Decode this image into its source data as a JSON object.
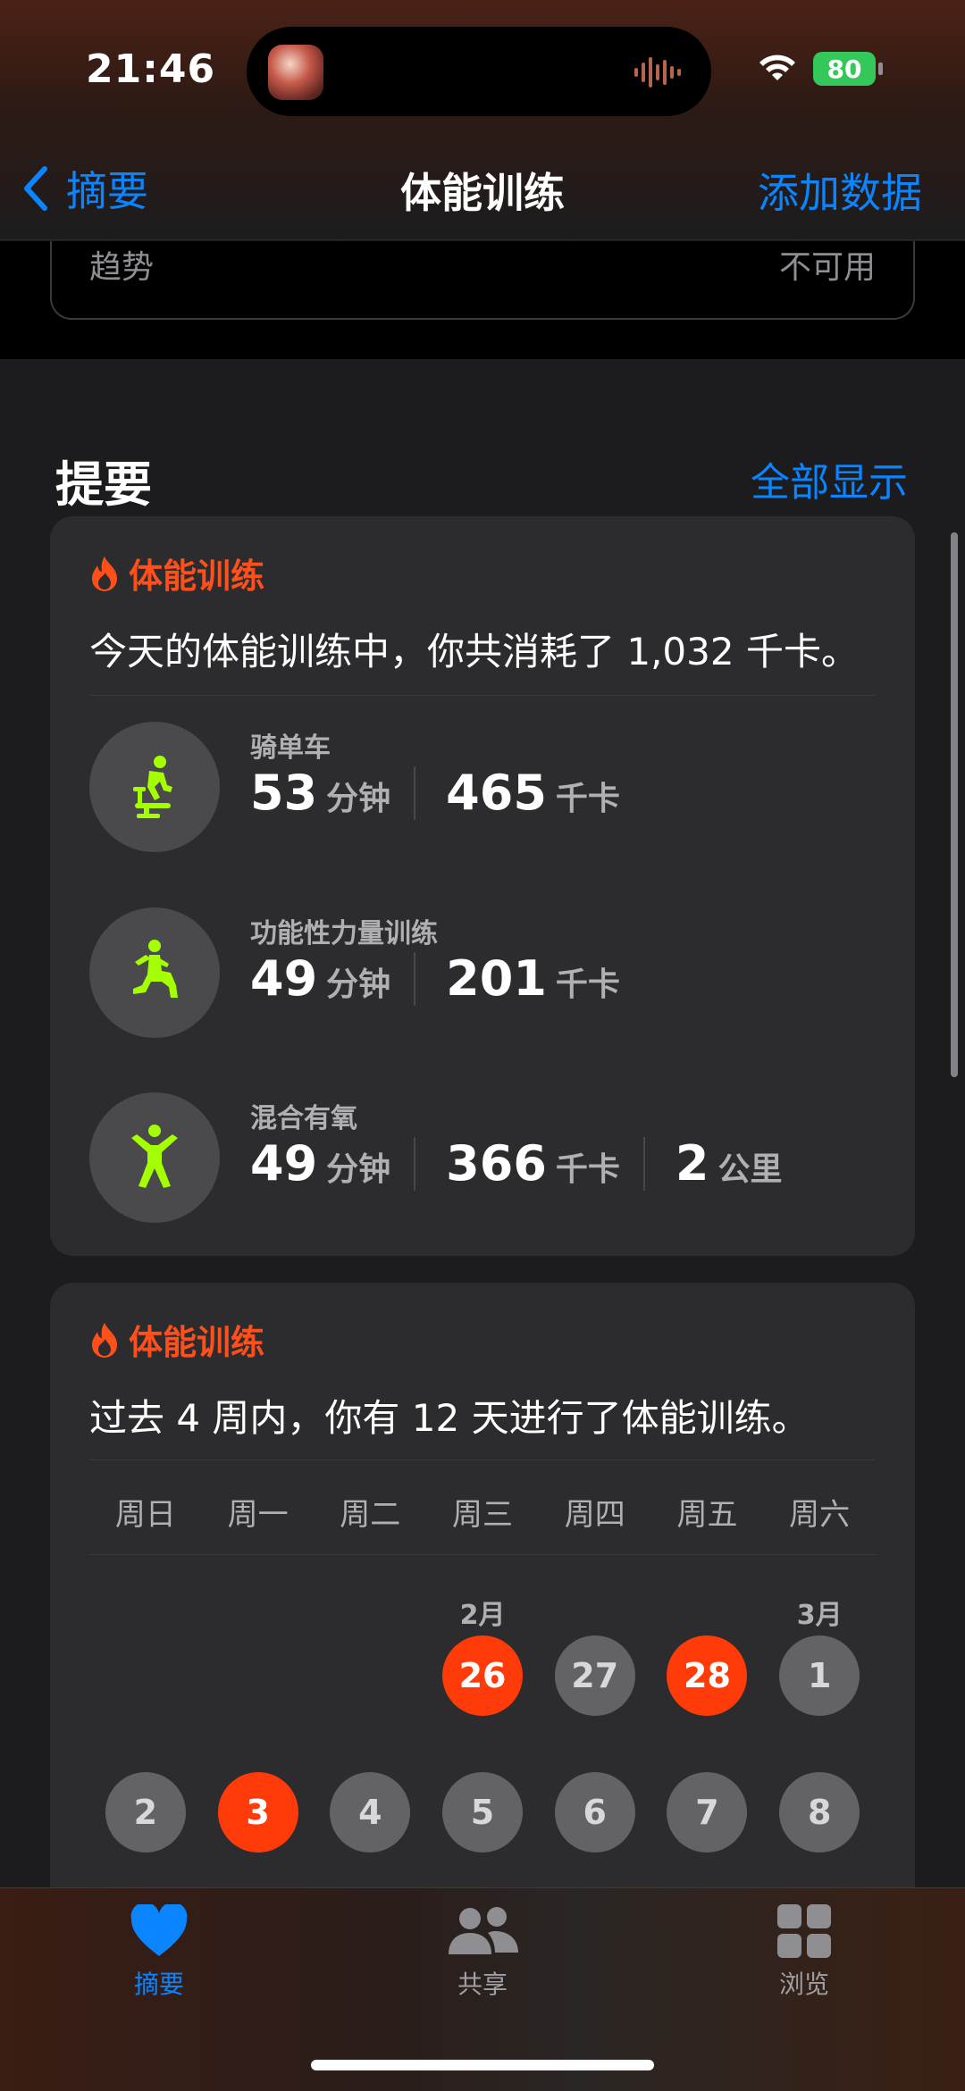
{
  "status_bar": {
    "time": "21:46",
    "battery": "80"
  },
  "nav": {
    "back_label": "摘要",
    "title": "体能训练",
    "action_label": "添加数据"
  },
  "prev_card": {
    "label": "趋势",
    "value": "不可用"
  },
  "section": {
    "title": "提要",
    "link": "全部显示"
  },
  "summary_card": {
    "heading": "体能训练",
    "text": "今天的体能训练中，你共消耗了 1,032 千卡。",
    "workouts": [
      {
        "name": "骑单车",
        "icon": "cycling-icon",
        "minutes": "53",
        "minutes_unit": "分钟",
        "kcal": "465",
        "kcal_unit": "千卡"
      },
      {
        "name": "功能性力量训练",
        "icon": "strength-training-icon",
        "minutes": "49",
        "minutes_unit": "分钟",
        "kcal": "201",
        "kcal_unit": "千卡"
      },
      {
        "name": "混合有氧",
        "icon": "mixed-cardio-icon",
        "minutes": "49",
        "minutes_unit": "分钟",
        "kcal": "366",
        "kcal_unit": "千卡",
        "distance": "2",
        "distance_unit": "公里"
      }
    ]
  },
  "calendar_card": {
    "heading": "体能训练",
    "text": "过去 4 周内，你有 12 天进行了体能训练。",
    "weekdays": [
      "周日",
      "周一",
      "周二",
      "周三",
      "周四",
      "周五",
      "周六"
    ],
    "row1": {
      "feb_label": "2月",
      "mar_label": "3月",
      "days": [
        "26",
        "27",
        "28",
        "1"
      ],
      "active": [
        true,
        false,
        true,
        false
      ]
    },
    "row2": {
      "days": [
        "2",
        "3",
        "4",
        "5",
        "6",
        "7",
        "8"
      ],
      "active": [
        false,
        true,
        false,
        false,
        false,
        false,
        false
      ]
    }
  },
  "colors": {
    "accent": "#0a84ff",
    "fitness": "#ff4f1a",
    "workout_icon": "#a4ff00",
    "battery": "#34c759"
  },
  "tabbar": {
    "summary": "摘要",
    "sharing": "共享",
    "browse": "浏览"
  }
}
